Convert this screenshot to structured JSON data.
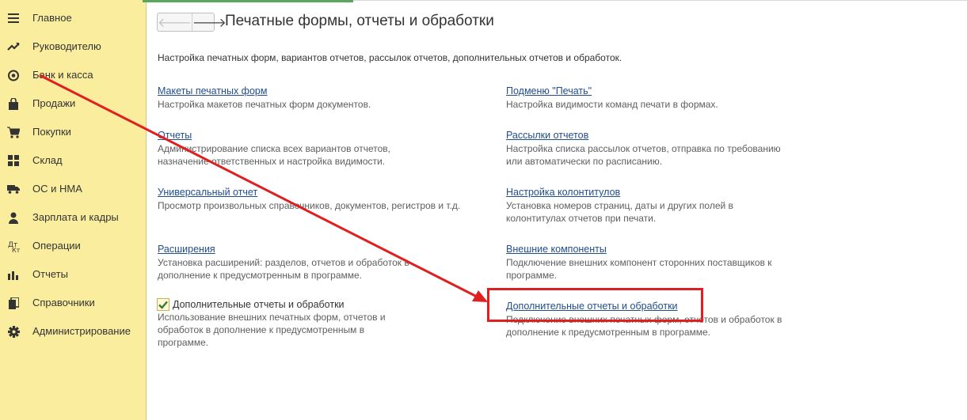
{
  "sidebar": {
    "items": [
      {
        "label": "Главное",
        "icon": "menu-icon"
      },
      {
        "label": "Руководителю",
        "icon": "trend-icon"
      },
      {
        "label": "Банк и касса",
        "icon": "coins-icon"
      },
      {
        "label": "Продажи",
        "icon": "shopping-bag-icon"
      },
      {
        "label": "Покупки",
        "icon": "cart-icon"
      },
      {
        "label": "Склад",
        "icon": "warehouse-grid-icon"
      },
      {
        "label": "ОС и НМА",
        "icon": "truck-icon"
      },
      {
        "label": "Зарплата и кадры",
        "icon": "person-icon"
      },
      {
        "label": "Операции",
        "icon": "operations-icon"
      },
      {
        "label": "Отчеты",
        "icon": "bar-chart-icon"
      },
      {
        "label": "Справочники",
        "icon": "books-icon"
      },
      {
        "label": "Администрирование",
        "icon": "gear-icon"
      }
    ]
  },
  "header": {
    "back_glyph": "🡐",
    "forward_glyph": "🡒",
    "title": "Печатные формы, отчеты и обработки"
  },
  "intro": "Настройка печатных форм, вариантов отчетов, рассылок отчетов, дополнительных отчетов и обработок.",
  "left_column": {
    "print_layouts": {
      "link": "Макеты печатных форм",
      "desc": "Настройка макетов печатных форм документов."
    },
    "reports": {
      "link": "Отчеты",
      "desc": "Администрирование списка всех вариантов отчетов,\nназначение ответственных и настройка видимости."
    },
    "universal_report": {
      "link": "Универсальный отчет",
      "desc": "Просмотр произвольных справочников, документов, регистров и т.д."
    },
    "extensions": {
      "link": "Расширения",
      "desc": "Установка расширений: разделов, отчетов и обработок в\nдополнение к предусмотренным в программе."
    },
    "additional_checkbox": {
      "label": "Дополнительные отчеты и обработки",
      "checked": true,
      "desc": "Использование внешних печатных форм, отчетов и\nобработок в дополнение к предусмотренным в\nпрограмме."
    }
  },
  "right_column": {
    "print_submenu": {
      "link": "Подменю \"Печать\"",
      "desc": "Настройка видимости команд печати в формах."
    },
    "report_mailings": {
      "link": "Рассылки отчетов",
      "desc": "Настройка списка рассылок отчетов, отправка по требованию\nили автоматически по расписанию."
    },
    "headers_footers": {
      "link": "Настройка колонтитулов",
      "desc": "Установка номеров страниц, даты и других полей в\nколонтитулах отчетов при печати."
    },
    "external_components": {
      "link": "Внешние компоненты",
      "desc": "Подключение внешних компонент сторонних поставщиков к\nпрограмме."
    },
    "additional_reports": {
      "link": "Дополнительные отчеты и обработки",
      "desc": "Подключение внешних печатных форм, отчетов и обработок в\nдополнение к предусмотренным в программе."
    }
  },
  "colors": {
    "sidebar_bg": "#fbed9e",
    "link": "#214e8f",
    "annotation_red": "#e02020",
    "tab_green": "#5aa65a"
  }
}
